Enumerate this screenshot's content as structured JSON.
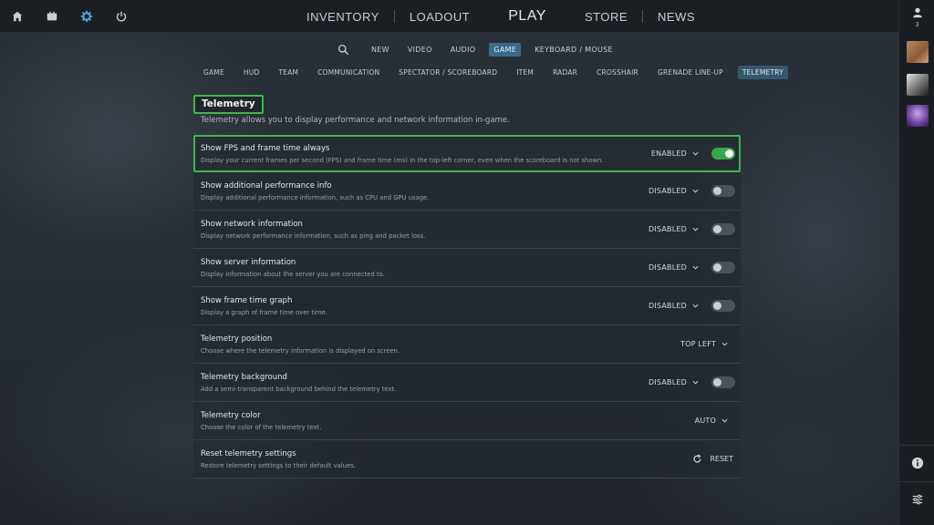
{
  "colors": {
    "accent": "#3fb64f",
    "active_tab": "#3a6a8a",
    "toggle_off": "#4b5259"
  },
  "top_icons": [
    "home-icon",
    "tv-icon",
    "gear-icon",
    "power-icon"
  ],
  "main_nav": [
    "INVENTORY",
    "LOADOUT",
    "PLAY",
    "STORE",
    "NEWS"
  ],
  "subnav": [
    "NEW",
    "VIDEO",
    "AUDIO",
    "GAME",
    "KEYBOARD / MOUSE"
  ],
  "subnav_active": "GAME",
  "catnav": [
    "GAME",
    "HUD",
    "TEAM",
    "COMMUNICATION",
    "SPECTATOR / SCOREBOARD",
    "ITEM",
    "RADAR",
    "CROSSHAIR",
    "GRENADE LINE-UP",
    "TELEMETRY"
  ],
  "catnav_active": "TELEMETRY",
  "rail": {
    "friend_count": "3"
  },
  "section": {
    "title": "Telemetry",
    "description": "Telemetry allows you to display performance and network information in-game."
  },
  "settings": [
    {
      "label": "Show FPS and frame time always",
      "desc": "Display your current frames per second (FPS) and frame time (ms) in the top-left corner, even when the scoreboard is not shown.",
      "value": "ENABLED",
      "toggle": true
    },
    {
      "label": "Show additional performance info",
      "desc": "Display additional performance information, such as CPU and GPU usage.",
      "value": "DISABLED",
      "toggle": false
    },
    {
      "label": "Show network information",
      "desc": "Display network performance information, such as ping and packet loss.",
      "value": "DISABLED",
      "toggle": false
    },
    {
      "label": "Show server information",
      "desc": "Display information about the server you are connected to.",
      "value": "DISABLED",
      "toggle": false
    },
    {
      "label": "Show frame time graph",
      "desc": "Display a graph of frame time over time.",
      "value": "DISABLED",
      "toggle": false
    },
    {
      "label": "Telemetry position",
      "desc": "Choose where the telemetry information is displayed on screen.",
      "value": "TOP LEFT"
    },
    {
      "label": "Telemetry background",
      "desc": "Add a semi-transparent background behind the telemetry text.",
      "value": "DISABLED",
      "toggle": false
    },
    {
      "label": "Telemetry color",
      "desc": "Choose the color of the telemetry text.",
      "value": "AUTO"
    },
    {
      "label": "Reset telemetry settings",
      "desc": "Restore telemetry settings to their default values.",
      "action": "RESET"
    }
  ]
}
